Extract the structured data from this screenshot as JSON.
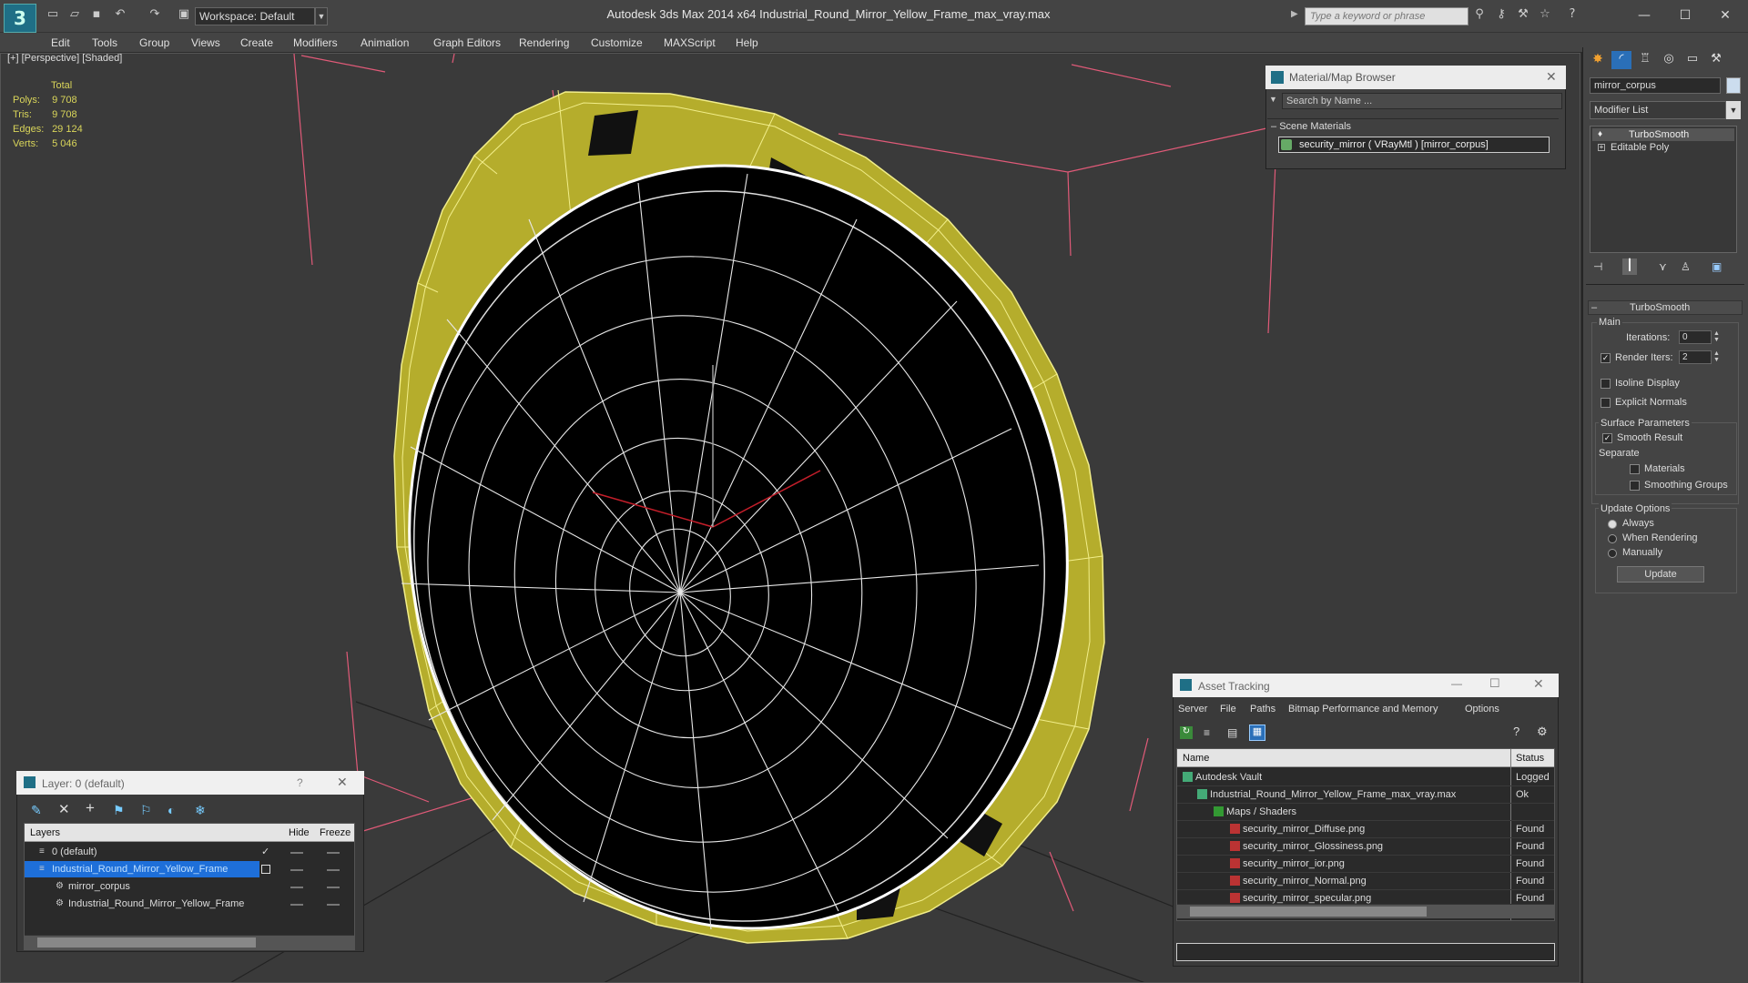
{
  "app": {
    "window_title": "Autodesk 3ds Max  2014 x64      Industrial_Round_Mirror_Yellow_Frame_max_vray.max",
    "workspace": "Workspace: Default",
    "search_placeholder": "Type a keyword or phrase"
  },
  "menu": [
    "Edit",
    "Tools",
    "Group",
    "Views",
    "Create",
    "Modifiers",
    "Animation",
    "Graph Editors",
    "Rendering",
    "Customize",
    "MAXScript",
    "Help"
  ],
  "viewport": {
    "label": "[+] [Perspective] [Shaded]",
    "stats": {
      "header": "Total",
      "rows": [
        {
          "key": "Polys:",
          "value": "9 708"
        },
        {
          "key": "Tris:",
          "value": "9 708"
        },
        {
          "key": "Edges:",
          "value": "29 124"
        },
        {
          "key": "Verts:",
          "value": "5 046"
        }
      ]
    }
  },
  "material_browser": {
    "title": "Material/Map Browser",
    "search_placeholder": "Search by Name ...",
    "section": "Scene Materials",
    "item": "security_mirror  ( VRayMtl ) [mirror_corpus]"
  },
  "asset_tracking": {
    "title": "Asset Tracking",
    "menu": [
      "Server",
      "File",
      "Paths",
      "Bitmap Performance and Memory",
      "Options"
    ],
    "columns": [
      "Name",
      "Status"
    ],
    "rows": [
      {
        "name": "Autodesk Vault",
        "status": "Logged C"
      },
      {
        "name": "Industrial_Round_Mirror_Yellow_Frame_max_vray.max",
        "status": "Ok"
      },
      {
        "name": "Maps / Shaders",
        "status": ""
      },
      {
        "name": "security_mirror_Diffuse.png",
        "status": "Found"
      },
      {
        "name": "security_mirror_Glossiness.png",
        "status": "Found"
      },
      {
        "name": "security_mirror_ior.png",
        "status": "Found"
      },
      {
        "name": "security_mirror_Normal.png",
        "status": "Found"
      },
      {
        "name": "security_mirror_specular.png",
        "status": "Found"
      }
    ]
  },
  "layer_panel": {
    "title": "Layer: 0 (default)",
    "help": "?",
    "columns": [
      "Layers",
      "Hide",
      "Freeze"
    ],
    "rows": [
      {
        "name": "0 (default)"
      },
      {
        "name": "Industrial_Round_Mirror_Yellow_Frame"
      },
      {
        "name": "mirror_corpus"
      },
      {
        "name": "Industrial_Round_Mirror_Yellow_Frame"
      }
    ]
  },
  "command_panel": {
    "object_name": "mirror_corpus",
    "modifier_list": "Modifier List",
    "stack": [
      "TurboSmooth",
      "Editable Poly"
    ],
    "rollout_title": "TurboSmooth",
    "main_label": "Main",
    "iterations_label": "Iterations:",
    "iterations_value": "0",
    "render_iters_label": "Render Iters:",
    "render_iters_value": "2",
    "isoline": "Isoline Display",
    "explicit_normals": "Explicit Normals",
    "surface_params": "Surface Parameters",
    "smooth_result": "Smooth Result",
    "separate": "Separate",
    "materials": "Materials",
    "smoothing_groups": "Smoothing Groups",
    "update_options": "Update Options",
    "always": "Always",
    "when_rendering": "When Rendering",
    "manually": "Manually",
    "update_button": "Update"
  },
  "colors": {
    "frame_yellow": "#b5ad2c",
    "selection_blue": "#1e6fd9",
    "stats_yellow": "#d9d55a"
  }
}
